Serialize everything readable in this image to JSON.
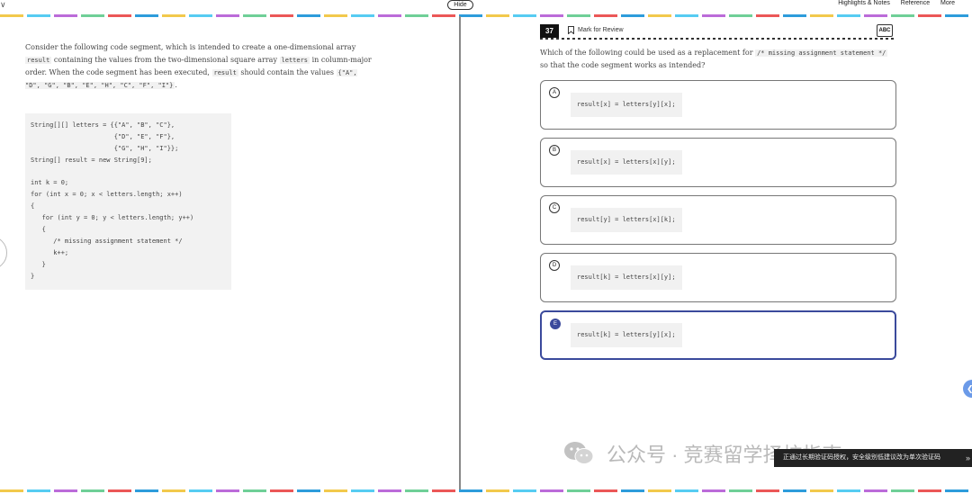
{
  "topbar": {
    "chevron": "∨",
    "hide_label": "Hide",
    "menu": [
      "Highlights & Notes",
      "Reference",
      "More"
    ]
  },
  "passage": {
    "t1": "Consider the following code segment, which is intended to create a one-dimensional array",
    "code1": "result",
    "t2": "containing the values from the two-dimensional square array",
    "code2": "letters",
    "t3": "in column-major order. When the code segment has been executed,",
    "code3": "result",
    "t4": "should contain the values",
    "code4": "{\"A\", \"D\", \"G\", \"B\", \"E\", \"H\", \"C\", \"F\", \"I\"}",
    "t5": "."
  },
  "code_block": {
    "lines": [
      "String[][] letters = {{\"A\", \"B\", \"C\"},",
      "                      {\"D\", \"E\", \"F\"},",
      "                      {\"G\", \"H\", \"I\"}};",
      "String[] result = new String[9];",
      "",
      "int k = 0;",
      "for (int x = 0; x < letters.length; x++)",
      "{",
      "   for (int y = 0; y < letters.length; y++)",
      "   {",
      "      /* missing assignment statement */",
      "      k++;",
      "   }",
      "}"
    ]
  },
  "question": {
    "number": "37",
    "mark_for_review": "Mark for Review",
    "abc_label": "ABC",
    "text1": "Which of the following could be used as a replacement for",
    "code": "/* missing assignment statement */",
    "text2": "so that the code segment works as intended?"
  },
  "choices": [
    {
      "letter": "A",
      "code": "result[x] = letters[y][x];"
    },
    {
      "letter": "B",
      "code": "result[x] = letters[x][y];"
    },
    {
      "letter": "C",
      "code": "result[y] = letters[x][k];"
    },
    {
      "letter": "D",
      "code": "result[k] = letters[x][y];"
    },
    {
      "letter": "E",
      "code": "result[k] = letters[y][x];"
    }
  ],
  "selected_choice": "E",
  "watermark": {
    "text": "公众号 · 竞赛留学择校指南"
  },
  "toast": {
    "text": "正通过长期验证码授权，安全级别低建议改为单次验证码",
    "arrow": "»"
  },
  "colors": {
    "selected": "#3b4a9c",
    "side_bubble": "#6b9ae8"
  }
}
